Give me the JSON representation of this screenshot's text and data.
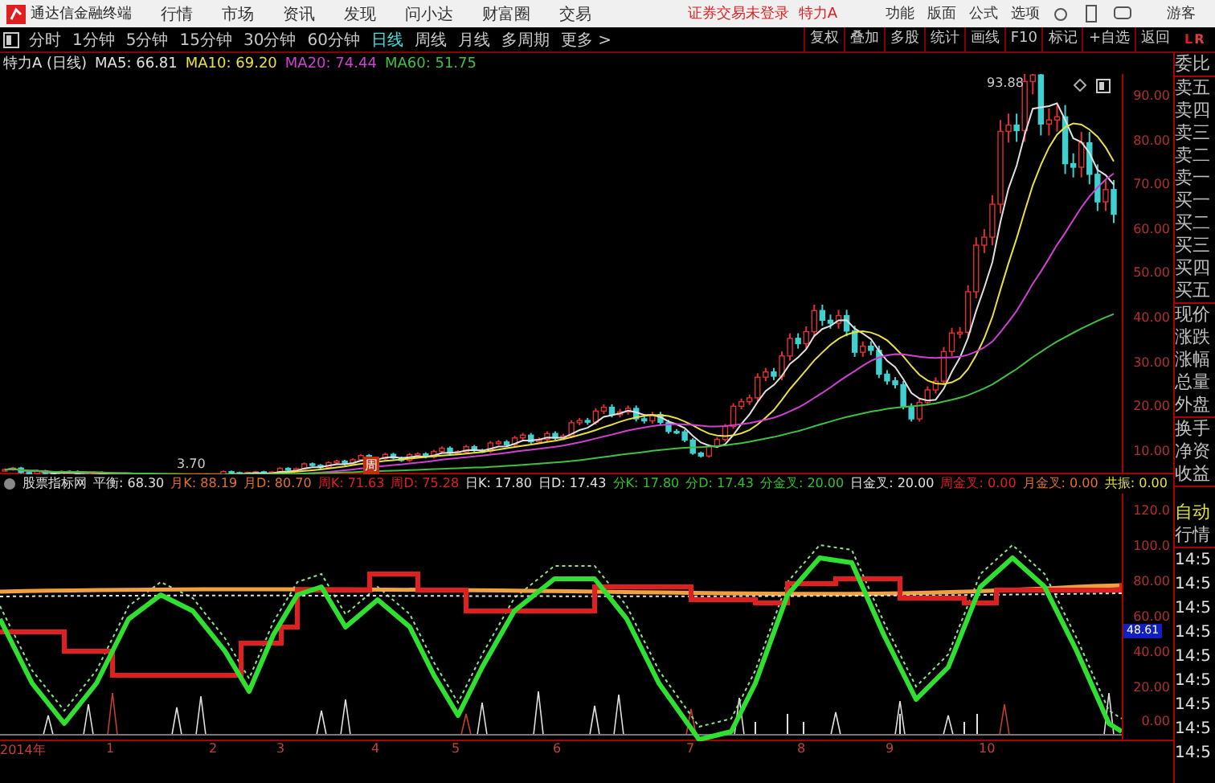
{
  "menu_bar": {
    "app_title": "通达信金融终端",
    "menus": [
      "行情",
      "市场",
      "资讯",
      "发现",
      "问小达",
      "财富圈",
      "交易"
    ],
    "login_status": "证券交易未登录",
    "stock": "特力A",
    "right_menus": [
      "功能",
      "版面",
      "公式",
      "选项"
    ],
    "user": "游客"
  },
  "toolbar": {
    "periods": [
      {
        "label": "分时",
        "selected": false
      },
      {
        "label": "1分钟",
        "selected": false
      },
      {
        "label": "5分钟",
        "selected": false
      },
      {
        "label": "15分钟",
        "selected": false
      },
      {
        "label": "30分钟",
        "selected": false
      },
      {
        "label": "60分钟",
        "selected": false
      },
      {
        "label": "日线",
        "selected": true
      },
      {
        "label": "周线",
        "selected": false
      },
      {
        "label": "月线",
        "selected": false
      },
      {
        "label": "多周期",
        "selected": false
      },
      {
        "label": "更多 >",
        "selected": false
      }
    ],
    "tools": [
      "复权",
      "叠加",
      "多股",
      "统计",
      "画线",
      "F10",
      "标记",
      "+自选",
      "返回"
    ]
  },
  "corner_mark": [
    "L",
    "R"
  ],
  "price_chart": {
    "title": "特力A (日线)",
    "ma": [
      {
        "label": "MA5: 66.81",
        "color": "#e0e0e0"
      },
      {
        "label": "MA10: 69.20",
        "color": "#e8e040"
      },
      {
        "label": "MA20: 74.44",
        "color": "#d040d0"
      },
      {
        "label": "MA60: 51.75",
        "color": "#40c040"
      }
    ],
    "high_label": "93.88",
    "low_label": "3.70",
    "marker": "周",
    "axis": [
      "90.00",
      "80.00",
      "70.00",
      "60.00",
      "50.00",
      "40.00",
      "30.00",
      "20.00",
      "10.00"
    ]
  },
  "indicator": {
    "name": "股票指标网",
    "values": [
      {
        "label": "平衡: 68.30",
        "color": "#e0e0e0"
      },
      {
        "label": "月K: 88.19",
        "color": "#e07030"
      },
      {
        "label": "月D: 80.70",
        "color": "#e07030"
      },
      {
        "label": "周K: 71.63",
        "color": "#e02020"
      },
      {
        "label": "周D: 75.28",
        "color": "#e02020"
      },
      {
        "label": "日K: 17.80",
        "color": "#e0e0e0"
      },
      {
        "label": "日D: 17.43",
        "color": "#e0e0e0"
      },
      {
        "label": "分K: 17.80",
        "color": "#30c030"
      },
      {
        "label": "分D: 17.43",
        "color": "#30c030"
      },
      {
        "label": "分金叉: 20.00",
        "color": "#30c030"
      },
      {
        "label": "日金叉: 20.00",
        "color": "#e0e0e0"
      },
      {
        "label": "周金叉: 0.00",
        "color": "#e02020"
      },
      {
        "label": "月金叉: 0.00",
        "color": "#e07030"
      },
      {
        "label": "共振: 0.00",
        "color": "#e0e040"
      }
    ],
    "axis": [
      "120.0",
      "100.0",
      "80.00",
      "60.00",
      "40.00",
      "20.00",
      "0.00"
    ],
    "current_value": "48.61"
  },
  "date_axis": [
    "2014年",
    "1",
    "2",
    "3",
    "4",
    "5",
    "6",
    "7",
    "8",
    "9",
    "10"
  ],
  "quote_panel": {
    "fields": [
      "委比",
      "卖五",
      "卖四",
      "卖三",
      "卖二",
      "卖一",
      "买一",
      "买二",
      "买三",
      "买四",
      "买五",
      "现价",
      "涨跌",
      "涨幅",
      "总量",
      "外盘",
      "换手",
      "净资",
      "收益"
    ],
    "mode": "自动",
    "section": "行情",
    "times": [
      "14:5",
      "14:5",
      "14:5",
      "14:5",
      "14:5",
      "14:5",
      "14:5",
      "14:5",
      "14:5"
    ]
  }
}
